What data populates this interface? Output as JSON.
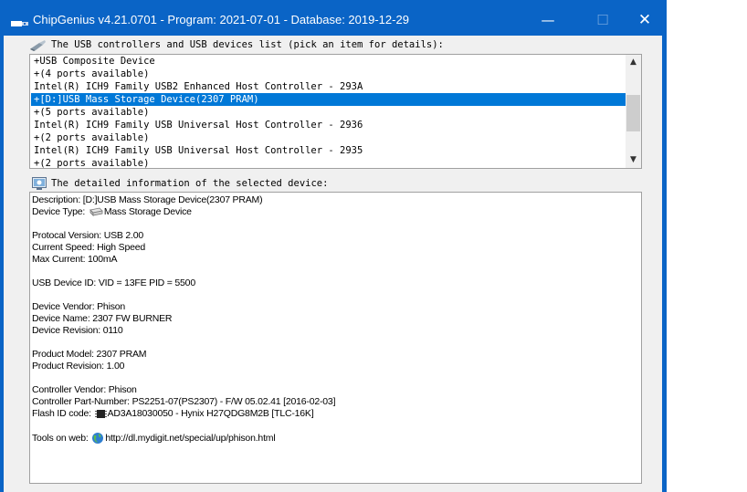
{
  "window": {
    "title": "ChipGenius v4.21.0701 - Program: 2021-07-01 - Database: 2019-12-29",
    "controls": {
      "minimize": "—",
      "maximize": "☐",
      "close": "✕"
    }
  },
  "device_list": {
    "label": "The USB controllers and USB devices list (pick an item for details):",
    "items": [
      "+USB Composite Device",
      "+(4 ports available)",
      "Intel(R) ICH9 Family USB2 Enhanced Host Controller - 293A",
      "+[D:]USB Mass Storage Device(2307 PRAM)",
      "+(5 ports available)",
      "Intel(R) ICH9 Family USB Universal Host Controller - 2936",
      "+(2 ports available)",
      "Intel(R) ICH9 Family USB Universal Host Controller - 2935",
      "+(2 ports available)"
    ],
    "selected_index": 3
  },
  "details": {
    "label": "The detailed information of the selected device:",
    "description": "Description: [D:]USB Mass Storage Device(2307 PRAM)",
    "device_type_label": "Device Type:",
    "device_type_value": "Mass Storage Device",
    "protocol_version": "Protocal Version: USB 2.00",
    "current_speed": "Current Speed: High Speed",
    "max_current": "Max Current: 100mA",
    "usb_device_id": "USB Device ID: VID = 13FE PID = 5500",
    "device_vendor": "Device Vendor: Phison",
    "device_name": "Device Name: 2307 FW BURNER",
    "device_revision": "Device Revision: 0110",
    "product_model": "Product Model: 2307 PRAM",
    "product_revision": "Product Revision: 1.00",
    "controller_vendor": "Controller Vendor: Phison",
    "controller_part_number": "Controller Part-Number: PS2251-07(PS2307) - F/W 05.02.41 [2016-02-03]",
    "flash_id_label": "Flash ID code:",
    "flash_id_value": "AD3A18030050 - Hynix H27QDG8M2B [TLC-16K]",
    "tools_label": "Tools on web:",
    "tools_url": "http://dl.mydigit.net/special/up/phison.html"
  },
  "icons": {
    "app": "usb-plug-icon",
    "list_label": "usb-plug-icon",
    "detail_label": "info-screen-icon",
    "device_type": "drive-icon",
    "flash_id": "chip-icon",
    "tools": "globe-icon"
  },
  "colors": {
    "titlebar": "#0a64c6",
    "selection": "#0078d7",
    "link": "#000000"
  }
}
